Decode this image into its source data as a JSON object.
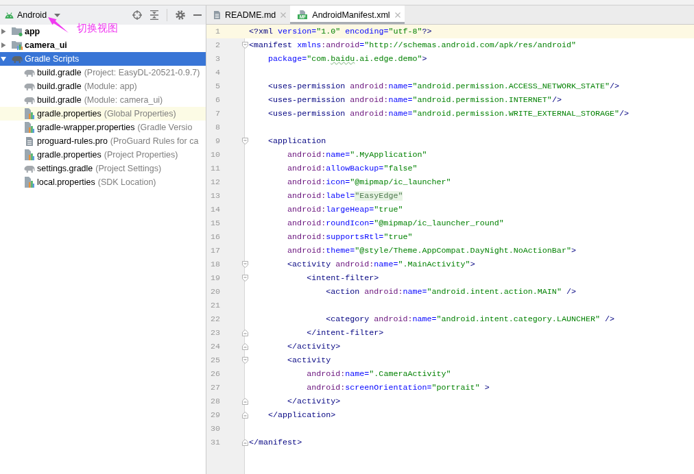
{
  "toolbar": {
    "view": "Android"
  },
  "annotation": {
    "text": "切换视图"
  },
  "tree": [
    {
      "label": "app",
      "kind": "module",
      "expanded": false,
      "selected": false
    },
    {
      "label": "camera_ui",
      "kind": "library",
      "expanded": false,
      "selected": false
    },
    {
      "label": "Gradle Scripts",
      "kind": "group",
      "expanded": true,
      "selected": true,
      "children": [
        {
          "label": "build.gradle",
          "detail": "(Project: EasyDL-20521-0.9.7)",
          "kind": "gradle",
          "selected": false,
          "highlighted": false
        },
        {
          "label": "build.gradle",
          "detail": "(Module: app)",
          "kind": "gradle",
          "selected": false,
          "highlighted": false
        },
        {
          "label": "build.gradle",
          "detail": "(Module: camera_ui)",
          "kind": "gradle",
          "selected": false,
          "highlighted": false
        },
        {
          "label": "gradle.properties",
          "detail": "(Global Properties)",
          "kind": "properties",
          "selected": false,
          "highlighted": true
        },
        {
          "label": "gradle-wrapper.properties",
          "detail": "(Gradle Versio",
          "kind": "properties",
          "selected": false,
          "highlighted": false
        },
        {
          "label": "proguard-rules.pro",
          "detail": "(ProGuard Rules for ca",
          "kind": "text",
          "selected": false,
          "highlighted": false
        },
        {
          "label": "gradle.properties",
          "detail": "(Project Properties)",
          "kind": "properties",
          "selected": false,
          "highlighted": false
        },
        {
          "label": "settings.gradle",
          "detail": "(Project Settings)",
          "kind": "gradle",
          "selected": false,
          "highlighted": false
        },
        {
          "label": "local.properties",
          "detail": "(SDK Location)",
          "kind": "properties",
          "selected": false,
          "highlighted": false
        }
      ]
    }
  ],
  "tabs": [
    {
      "label": "README.md",
      "kind": "text",
      "selected": false
    },
    {
      "label": "AndroidManifest.xml",
      "kind": "manifest",
      "badge": "MF",
      "selected": true
    }
  ],
  "editor": {
    "lines": [
      {
        "number": "1",
        "kind": "plain",
        "current": true,
        "tokens": [
          {
            "kind": "tag",
            "text": "<?xml"
          },
          {
            "kind": "attr",
            "text": " version="
          },
          {
            "kind": "value",
            "text": "\"1.0\""
          },
          {
            "kind": "attr",
            "text": " encoding="
          },
          {
            "kind": "value",
            "text": "\"utf-8\""
          },
          {
            "kind": "tag",
            "text": "?>"
          }
        ]
      },
      {
        "number": "2",
        "kind": "opening",
        "current": false,
        "tokens": [
          {
            "kind": "tag",
            "text": "<manifest"
          },
          {
            "kind": "attr",
            "text": " xmlns"
          },
          {
            "kind": "ns",
            "text": ":android"
          },
          {
            "kind": "attr",
            "text": "="
          },
          {
            "kind": "value",
            "text": "\"http://schemas.android.com/apk/res/android\""
          }
        ],
        "children": [
          {
            "number": "3",
            "kind": "plain",
            "current": false,
            "tokens": [
              {
                "kind": "attr",
                "text": "package="
              },
              {
                "kind": "value",
                "text": "\"com."
              },
              {
                "kind": "typo",
                "text": "baidu"
              },
              {
                "kind": "value",
                "text": ".ai.edge.demo\""
              },
              {
                "kind": "tag",
                "text": ">"
              }
            ]
          },
          {
            "number": "4",
            "kind": "plain",
            "current": false
          },
          {
            "number": "5",
            "kind": "plain",
            "current": false,
            "tokens": [
              {
                "kind": "tag",
                "text": "<uses-permission"
              },
              {
                "kind": "ns",
                "text": " android:"
              },
              {
                "kind": "attr",
                "text": "name="
              },
              {
                "kind": "value",
                "text": "\"android.permission.ACCESS_NETWORK_STATE\""
              },
              {
                "kind": "tag",
                "text": "/>"
              }
            ]
          },
          {
            "number": "6",
            "kind": "plain",
            "current": false,
            "tokens": [
              {
                "kind": "tag",
                "text": "<uses-permission"
              },
              {
                "kind": "ns",
                "text": " android:"
              },
              {
                "kind": "attr",
                "text": "name="
              },
              {
                "kind": "value",
                "text": "\"android.permission.INTERNET\""
              },
              {
                "kind": "tag",
                "text": "/>"
              }
            ]
          },
          {
            "number": "7",
            "kind": "plain",
            "current": false,
            "tokens": [
              {
                "kind": "tag",
                "text": "<uses-permission"
              },
              {
                "kind": "ns",
                "text": " android:"
              },
              {
                "kind": "attr",
                "text": "name="
              },
              {
                "kind": "value",
                "text": "\"android.permission.WRITE_EXTERNAL_STORAGE\""
              },
              {
                "kind": "tag",
                "text": "/>"
              }
            ]
          },
          {
            "number": "8",
            "kind": "plain",
            "current": false
          },
          {
            "number": "9",
            "kind": "opening",
            "current": false,
            "tokens": [
              {
                "kind": "tag",
                "text": "<application"
              }
            ],
            "children": [
              {
                "number": "10",
                "kind": "plain",
                "current": false,
                "tokens": [
                  {
                    "kind": "ns",
                    "text": "android:"
                  },
                  {
                    "kind": "attr",
                    "text": "name="
                  },
                  {
                    "kind": "value",
                    "text": "\".MyApplication\""
                  }
                ]
              },
              {
                "number": "11",
                "kind": "plain",
                "current": false,
                "tokens": [
                  {
                    "kind": "ns",
                    "text": "android:"
                  },
                  {
                    "kind": "attr",
                    "text": "allowBackup="
                  },
                  {
                    "kind": "value",
                    "text": "\"false\""
                  }
                ]
              },
              {
                "number": "12",
                "kind": "plain",
                "current": false,
                "tokens": [
                  {
                    "kind": "ns",
                    "text": "android:"
                  },
                  {
                    "kind": "attr",
                    "text": "icon="
                  },
                  {
                    "kind": "value",
                    "text": "\"@mipmap/ic_launcher\""
                  }
                ]
              },
              {
                "number": "13",
                "kind": "plain",
                "current": false,
                "tokens": [
                  {
                    "kind": "ns",
                    "text": "android:"
                  },
                  {
                    "kind": "attr",
                    "text": "label="
                  },
                  {
                    "kind": "folded",
                    "text": "\"EasyEdge\""
                  }
                ]
              },
              {
                "number": "14",
                "kind": "plain",
                "current": false,
                "tokens": [
                  {
                    "kind": "ns",
                    "text": "android:"
                  },
                  {
                    "kind": "attr",
                    "text": "largeHeap="
                  },
                  {
                    "kind": "value",
                    "text": "\"true\""
                  }
                ]
              },
              {
                "number": "15",
                "kind": "plain",
                "current": false,
                "tokens": [
                  {
                    "kind": "ns",
                    "text": "android:"
                  },
                  {
                    "kind": "attr",
                    "text": "roundIcon="
                  },
                  {
                    "kind": "value",
                    "text": "\"@mipmap/ic_launcher_round\""
                  }
                ]
              },
              {
                "number": "16",
                "kind": "plain",
                "current": false,
                "tokens": [
                  {
                    "kind": "ns",
                    "text": "android:"
                  },
                  {
                    "kind": "attr",
                    "text": "supportsRtl="
                  },
                  {
                    "kind": "value",
                    "text": "\"true\""
                  }
                ]
              },
              {
                "number": "17",
                "kind": "plain",
                "current": false,
                "tokens": [
                  {
                    "kind": "ns",
                    "text": "android:"
                  },
                  {
                    "kind": "attr",
                    "text": "theme="
                  },
                  {
                    "kind": "value",
                    "text": "\"@style/Theme.AppCompat.DayNight.NoActionBar\""
                  },
                  {
                    "kind": "tag",
                    "text": ">"
                  }
                ]
              },
              {
                "number": "18",
                "kind": "opening",
                "current": false,
                "tokens": [
                  {
                    "kind": "tag",
                    "text": "<activity"
                  },
                  {
                    "kind": "ns",
                    "text": " android:"
                  },
                  {
                    "kind": "attr",
                    "text": "name="
                  },
                  {
                    "kind": "value",
                    "text": "\".MainActivity\""
                  },
                  {
                    "kind": "tag",
                    "text": ">"
                  }
                ],
                "children": [
                  {
                    "number": "19",
                    "kind": "opening",
                    "current": false,
                    "tokens": [
                      {
                        "kind": "tag",
                        "text": "<intent-filter>"
                      }
                    ],
                    "children": [
                      {
                        "number": "20",
                        "current": false,
                        "tokens": [
                          {
                            "kind": "tag",
                            "text": "<action"
                          },
                          {
                            "kind": "ns",
                            "text": " android:"
                          },
                          {
                            "kind": "attr",
                            "text": "name="
                          },
                          {
                            "kind": "value",
                            "text": "\"android.intent.action.MAIN\""
                          },
                          {
                            "kind": "tag",
                            "text": " />"
                          }
                        ]
                      },
                      {
                        "number": "21",
                        "current": false
                      },
                      {
                        "number": "22",
                        "current": false,
                        "tokens": [
                          {
                            "kind": "tag",
                            "text": "<category"
                          },
                          {
                            "kind": "ns",
                            "text": " android:"
                          },
                          {
                            "kind": "attr",
                            "text": "name="
                          },
                          {
                            "kind": "value",
                            "text": "\"android.intent.category.LAUNCHER\""
                          },
                          {
                            "kind": "tag",
                            "text": " />"
                          }
                        ]
                      }
                    ]
                  },
                  {
                    "number": "23",
                    "kind": "closing",
                    "current": false,
                    "tokens": [
                      {
                        "kind": "tag",
                        "text": "</intent-filter>"
                      }
                    ]
                  }
                ]
              },
              {
                "number": "24",
                "kind": "closing",
                "current": false,
                "tokens": [
                  {
                    "kind": "tag",
                    "text": "</activity>"
                  }
                ]
              },
              {
                "number": "25",
                "kind": "opening",
                "current": false,
                "tokens": [
                  {
                    "kind": "tag",
                    "text": "<activity"
                  }
                ],
                "children": [
                  {
                    "number": "26",
                    "current": false,
                    "tokens": [
                      {
                        "kind": "ns",
                        "text": "android:"
                      },
                      {
                        "kind": "attr",
                        "text": "name="
                      },
                      {
                        "kind": "value",
                        "text": "\".CameraActivity\""
                      }
                    ]
                  },
                  {
                    "number": "27",
                    "current": false,
                    "tokens": [
                      {
                        "kind": "ns",
                        "text": "android:"
                      },
                      {
                        "kind": "attr",
                        "text": "screenOrientation="
                      },
                      {
                        "kind": "value",
                        "text": "\"portrait\""
                      },
                      {
                        "kind": "tag",
                        "text": " >"
                      }
                    ]
                  }
                ]
              },
              {
                "number": "28",
                "kind": "closing",
                "current": false,
                "tokens": [
                  {
                    "kind": "tag",
                    "text": "</activity>"
                  }
                ]
              }
            ]
          },
          {
            "number": "29",
            "kind": "closing",
            "current": false,
            "tokens": [
              {
                "kind": "tag",
                "text": "</application>"
              }
            ]
          },
          {
            "number": "30",
            "kind": "plain",
            "current": false
          }
        ]
      },
      {
        "number": "31",
        "kind": "closing",
        "current": false,
        "tokens": [
          {
            "kind": "tag",
            "text": "</manifest>"
          }
        ]
      }
    ]
  }
}
